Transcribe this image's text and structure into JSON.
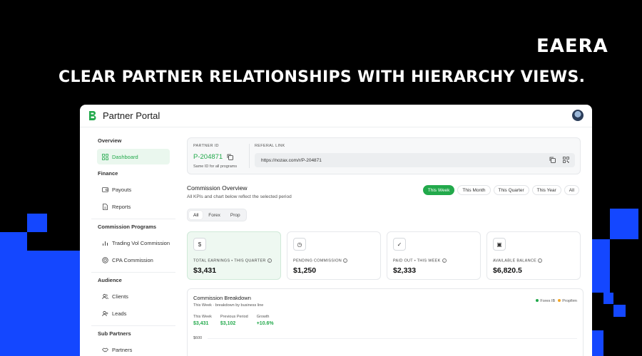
{
  "promo": {
    "brand": "EAERA",
    "headline": "CLEAR PARTNER RELATIONSHIPS WITH HIERARCHY VIEWS."
  },
  "app": {
    "title": "Partner Portal"
  },
  "sidebar": {
    "sections": [
      {
        "title": "Overview",
        "items": [
          {
            "label": "Dashboard",
            "icon": "dashboard-icon",
            "active": true
          }
        ]
      },
      {
        "title": "Finance",
        "items": [
          {
            "label": "Payouts",
            "icon": "wallet-icon"
          },
          {
            "label": "Reports",
            "icon": "document-icon"
          }
        ]
      },
      {
        "title": "Commission Programs",
        "items": [
          {
            "label": "Trading Vol Commission",
            "icon": "bar-chart-icon"
          },
          {
            "label": "CPA Commission",
            "icon": "target-icon"
          }
        ]
      },
      {
        "title": "Audience",
        "items": [
          {
            "label": "Clients",
            "icon": "users-icon"
          },
          {
            "label": "Leads",
            "icon": "user-plus-icon"
          }
        ]
      },
      {
        "title": "Sub Partners",
        "items": [
          {
            "label": "Partners",
            "icon": "handshake-icon"
          }
        ]
      }
    ]
  },
  "partner": {
    "id_label": "PARTNER ID",
    "id": "P-204871",
    "id_note": "Same ID for all programs",
    "ref_label": "REFERAL LINK",
    "ref_link": "https://nozax.com/r/P-204871"
  },
  "overview": {
    "title": "Commission Overview",
    "subtitle": "All KPIs and chart below reflect the selected period",
    "periods": [
      "This Week",
      "This Month",
      "This Quarter",
      "This Year",
      "All"
    ],
    "active_period": "This Week",
    "lines": [
      "All",
      "Forex",
      "Prop"
    ],
    "active_line": "All"
  },
  "kpis": [
    {
      "label": "TOTAL EARNINGS • THIS QUARTER",
      "value": "$3,431",
      "icon": "$"
    },
    {
      "label": "PENDING COMMISSION",
      "value": "$1,250",
      "icon": "◷"
    },
    {
      "label": "PAID OUT • THIS WEEK",
      "value": "$2,333",
      "icon": "✓"
    },
    {
      "label": "AVAILABLE BALANCE",
      "value": "$6,820.5",
      "icon": "▣"
    }
  ],
  "breakdown": {
    "title": "Commission Breakdown",
    "subtitle": "This Week · breakdown by business line",
    "legend": [
      {
        "name": "Forex IB",
        "color": "#22a94b"
      },
      {
        "name": "Propfirm",
        "color": "#f5a623"
      }
    ],
    "stats": [
      {
        "label": "This Week",
        "value": "$3,431"
      },
      {
        "label": "Previous Period",
        "value": "$3,102"
      },
      {
        "label": "Growth",
        "value": "+10.6%"
      }
    ],
    "y_tick": "$600"
  },
  "colors": {
    "accent": "#22a94b",
    "promo_blue": "#1447ff",
    "background": "#000000"
  }
}
